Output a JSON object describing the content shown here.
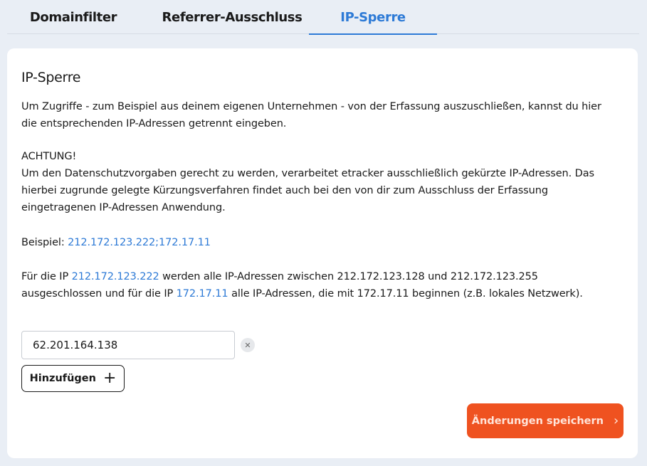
{
  "tabs": [
    {
      "label": "Domainfilter",
      "active": false
    },
    {
      "label": "Referrer-Ausschluss",
      "active": false
    },
    {
      "label": "IP-Sperre",
      "active": true
    }
  ],
  "colors": {
    "accent": "#2d7ad6",
    "primary_button": "#ef5220",
    "background": "#e9eef5"
  },
  "card": {
    "title": "IP-Sperre",
    "intro": "Um Zugriffe - zum Beispiel aus deinem eigenen Unternehmen - von der Erfassung auszuschließen, kannst du hier die entsprechenden IP-Adressen getrennt eingeben.",
    "warning_title": "ACHTUNG!",
    "warning_text": "Um den Datenschutzvorgaben gerecht zu werden, verarbeitet etracker ausschließlich gekürzte IP-Adressen. Das hierbei zugrunde gelegte Kürzungsverfahren findet auch bei den von dir zum Ausschluss der Erfassung eingetragenen IP-Adressen Anwendung.",
    "example_label": "Beispiel: ",
    "example_value": "212.172.123.222;172.17.11",
    "explanation": {
      "part1": "Für die IP ",
      "ip1": "212.172.123.222",
      "part2": " werden alle IP-Adressen zwischen 212.172.123.128 und 212.172.123.255 ausgeschlossen und für die IP ",
      "ip2": "172.17.11",
      "part3": " alle IP-Adressen, die mit 172.17.11 beginnen (z.B. lokales Netzwerk)."
    },
    "ip_entries": [
      {
        "value": "62.201.164.138"
      }
    ],
    "clear_icon": "close-icon",
    "add_label": "Hinzufügen",
    "add_icon": "plus-icon",
    "save_label": "Änderungen speichern",
    "save_icon": "chevron-right-icon"
  }
}
